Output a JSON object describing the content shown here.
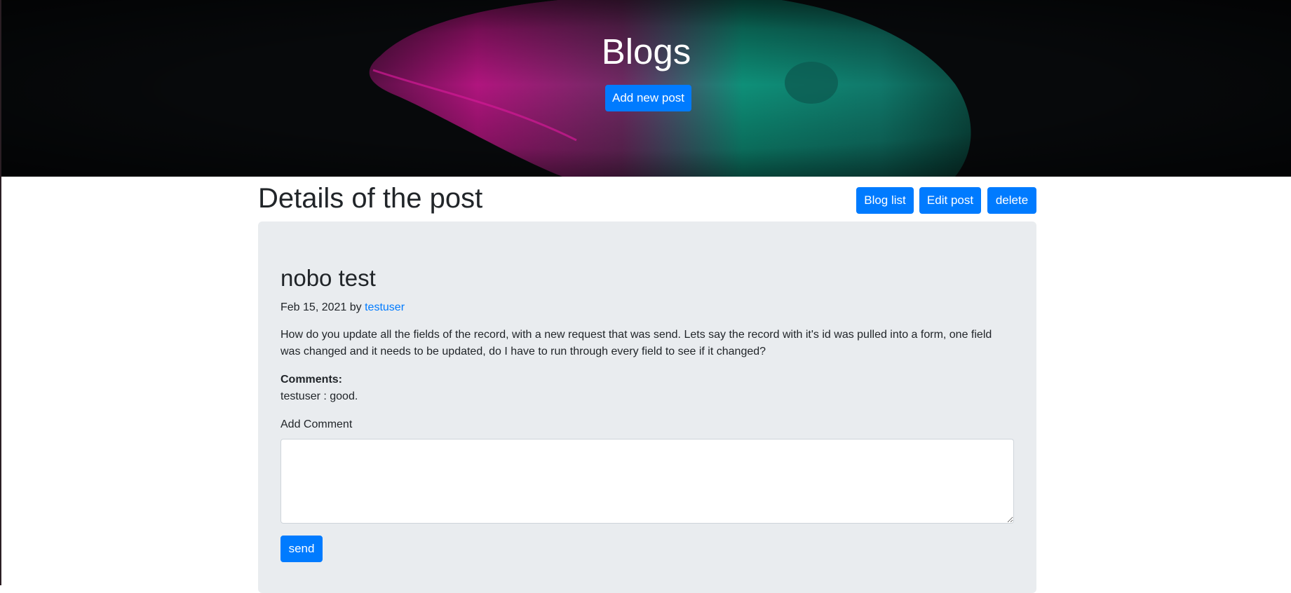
{
  "hero": {
    "title": "Blogs",
    "add_post_label": "Add new post"
  },
  "page": {
    "title": "Details of the post"
  },
  "toolbar": {
    "blog_list_label": "Blog list",
    "edit_post_label": "Edit post",
    "delete_label": "delete"
  },
  "post": {
    "title": "nobo test",
    "date": "Feb 15, 2021",
    "by_text": "by",
    "author": "testuser",
    "body": "How do you update all the fields of the record, with a new request that was send. Lets say the record with it's id was pulled into a form, one field was changed and it needs to be updated, do I have to run through every field to see if it changed?"
  },
  "comments": {
    "label": "Comments:",
    "items": [
      {
        "text": "testuser : good."
      }
    ]
  },
  "comment_form": {
    "label": "Add Comment",
    "value": "",
    "send_label": "send"
  },
  "colors": {
    "accent": "#007bff",
    "card_bg": "#e9ecef",
    "hero_bg": "#07090b",
    "text": "#212529"
  }
}
